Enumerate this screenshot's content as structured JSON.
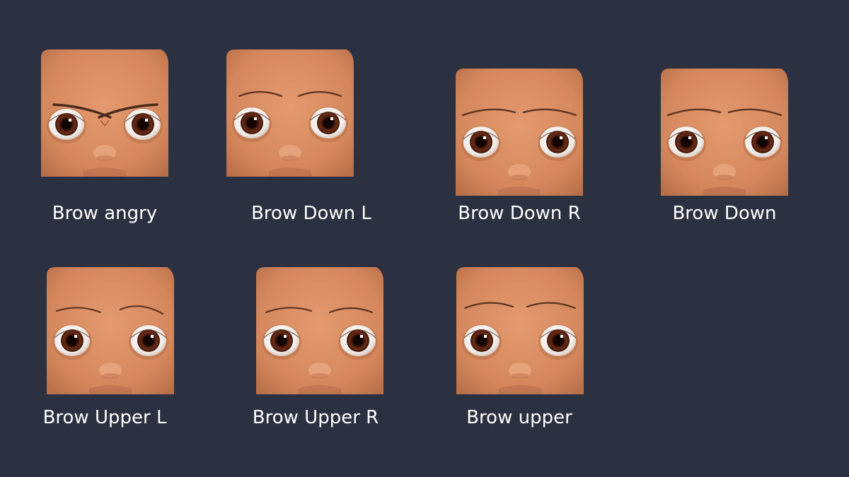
{
  "background_color": "#2b3140",
  "skin_color": "#d88e63",
  "iris_color": "#5a2514",
  "expressions": [
    {
      "label": "Brow angry",
      "brow": "angry"
    },
    {
      "label": "Brow Down L",
      "brow": "neutral"
    },
    {
      "label": "Brow Down R",
      "brow": "down"
    },
    {
      "label": "Brow Down",
      "brow": "down"
    },
    {
      "label": "Brow Upper L",
      "brow": "upper-l"
    },
    {
      "label": "Brow Upper R",
      "brow": "upper-r"
    },
    {
      "label": "Brow upper",
      "brow": "upper"
    }
  ]
}
